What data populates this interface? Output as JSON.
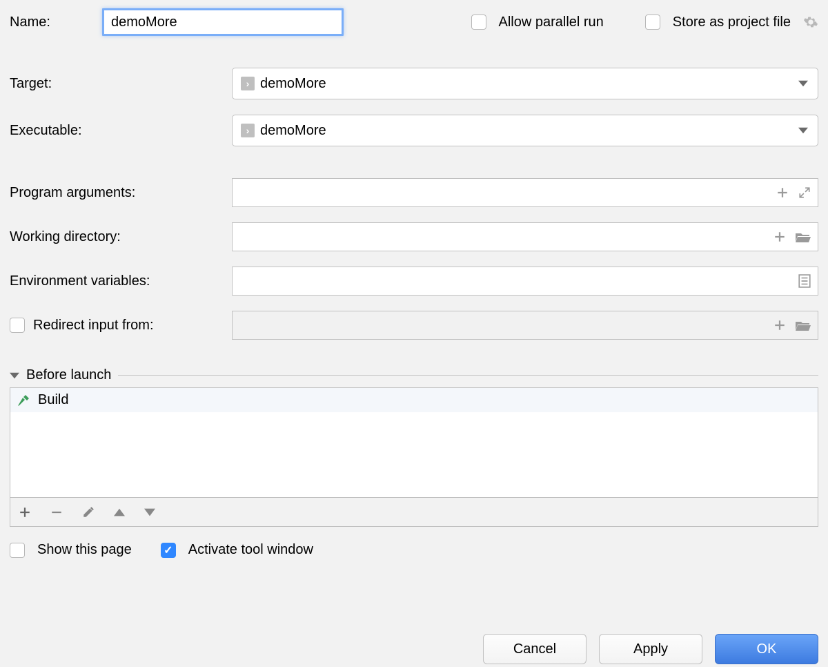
{
  "header": {
    "name_label": "Name:",
    "name_value": "demoMore",
    "allow_parallel_label": "Allow parallel run",
    "allow_parallel_checked": false,
    "store_label": "Store as project file",
    "store_checked": false
  },
  "fields": {
    "target_label": "Target:",
    "target_value": "demoMore",
    "executable_label": "Executable:",
    "executable_value": "demoMore",
    "program_args_label": "Program arguments:",
    "program_args_value": "",
    "working_dir_label": "Working directory:",
    "working_dir_value": "",
    "env_vars_label": "Environment variables:",
    "env_vars_value": "",
    "redirect_label": "Redirect input from:",
    "redirect_checked": false,
    "redirect_value": ""
  },
  "before_launch": {
    "title": "Before launch",
    "tasks": [
      "Build"
    ]
  },
  "options": {
    "show_page_label": "Show this page",
    "show_page_checked": false,
    "activate_tool_label": "Activate tool window",
    "activate_tool_checked": true
  },
  "footer": {
    "cancel": "Cancel",
    "apply": "Apply",
    "ok": "OK"
  }
}
